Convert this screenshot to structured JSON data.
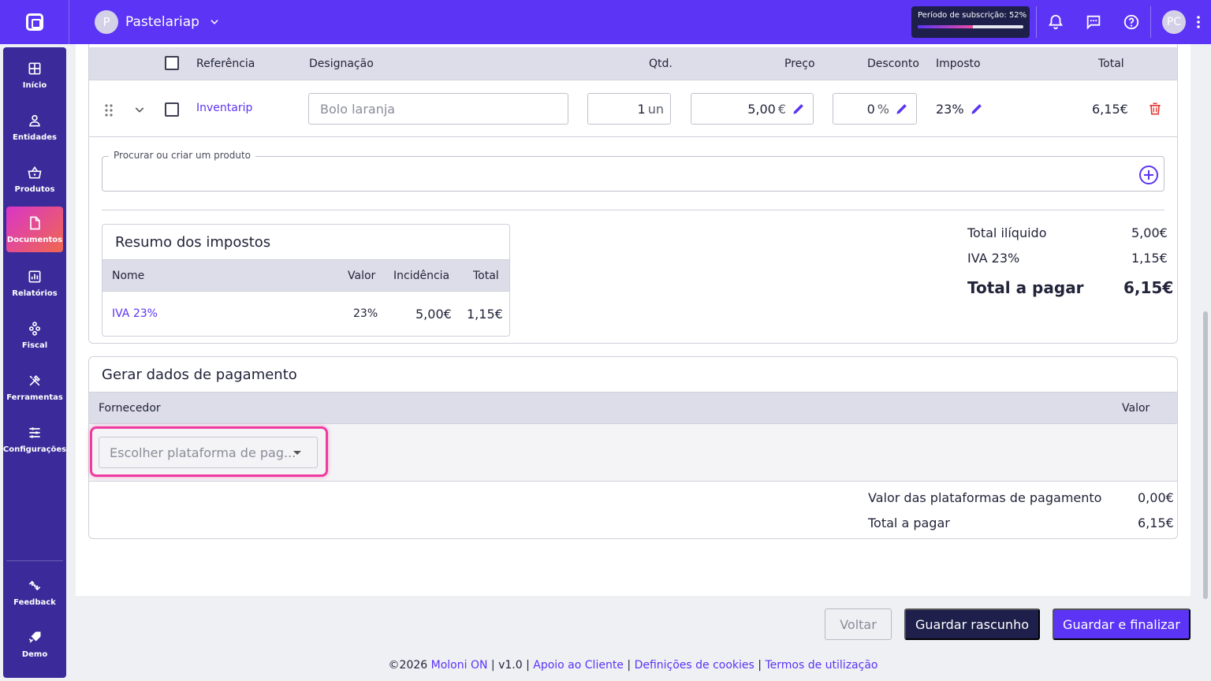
{
  "company": {
    "initial": "P",
    "name": "Pastelariap"
  },
  "subscription": {
    "label": "Período de subscrição: 52%",
    "progress": 0.52
  },
  "user": {
    "initials": "PC"
  },
  "sidebar": {
    "items": [
      {
        "label": "Início",
        "icon": "grid-icon"
      },
      {
        "label": "Entidades",
        "icon": "person-icon"
      },
      {
        "label": "Produtos",
        "icon": "basket-icon"
      },
      {
        "label": "Documentos",
        "icon": "document-icon",
        "active": true
      },
      {
        "label": "Relatórios",
        "icon": "chart-icon"
      },
      {
        "label": "Fiscal",
        "icon": "hierarchy-icon"
      },
      {
        "label": "Ferramentas",
        "icon": "tools-icon"
      },
      {
        "label": "Configurações",
        "icon": "sliders-icon"
      }
    ],
    "bottom": [
      {
        "label": "Feedback",
        "icon": "feedback-icon"
      },
      {
        "label": "Demo",
        "icon": "rocket-icon"
      }
    ]
  },
  "lines_table": {
    "headers": {
      "reference": "Referência",
      "designation": "Designação",
      "qty": "Qtd.",
      "price": "Preço",
      "discount": "Desconto",
      "tax": "Imposto",
      "total": "Total"
    },
    "row": {
      "reference": "Inventarip",
      "designation_placeholder": "Bolo laranja",
      "qty": "1",
      "qty_unit": "un",
      "price": "5,00",
      "price_unit": "€",
      "discount": "0",
      "discount_unit": "%",
      "tax": "23%",
      "total": "6,15€"
    }
  },
  "product_search": {
    "label": "Procurar ou criar um produto"
  },
  "tax_summary": {
    "title": "Resumo dos impostos",
    "headers": {
      "name": "Nome",
      "value": "Valor",
      "incidence": "Incidência",
      "total": "Total"
    },
    "rows": [
      {
        "name": "IVA 23%",
        "value": "23%",
        "incidence": "5,00€",
        "total": "1,15€"
      }
    ]
  },
  "totals": {
    "net_label": "Total ilíquido",
    "net_value": "5,00€",
    "vat_label": "IVA 23%",
    "vat_value": "1,15€",
    "pay_label": "Total a pagar",
    "pay_value": "6,15€"
  },
  "payment": {
    "title": "Gerar dados de pagamento",
    "headers": {
      "provider": "Fornecedor",
      "value": "Valor"
    },
    "select_placeholder": "Escolher plataforma de pag...",
    "platforms_label": "Valor das plataformas de pagamento",
    "platforms_value": "0,00€",
    "total_label": "Total a pagar",
    "total_value": "6,15€"
  },
  "actions": {
    "back": "Voltar",
    "draft": "Guardar rascunho",
    "finalize": "Guardar e finalizar"
  },
  "footer": {
    "copyright": "©2026",
    "brand": "Moloni ON",
    "version": "v1.0",
    "support": "Apoio ao Cliente",
    "cookies": "Definições de cookies",
    "terms": "Termos de utilização"
  },
  "colors": {
    "accent": "#5b34f5",
    "sidebar": "#3a2a9a",
    "highlight": "#ef3b9f",
    "danger": "#e53935"
  }
}
